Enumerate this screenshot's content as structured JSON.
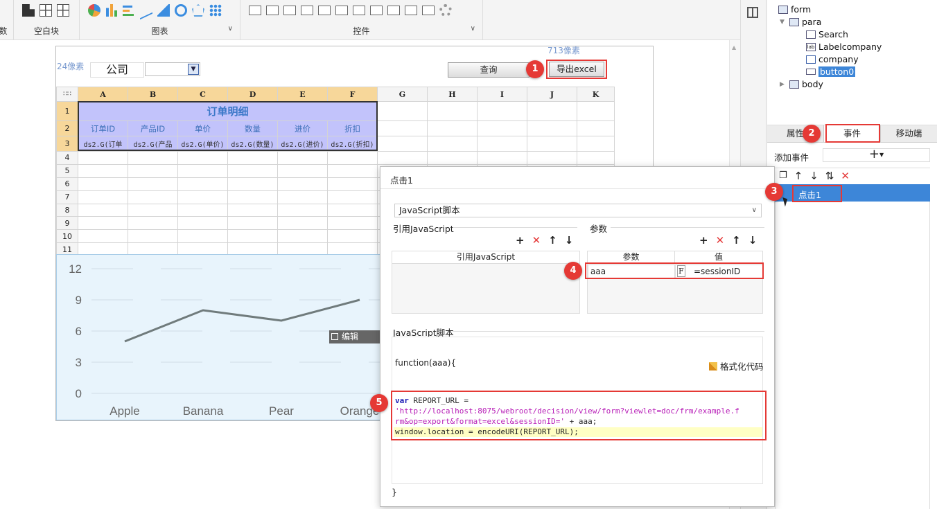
{
  "toolbar": {
    "groups": [
      {
        "label": "数"
      },
      {
        "label": "空白块"
      },
      {
        "label": "图表"
      },
      {
        "label": "控件"
      }
    ]
  },
  "report": {
    "px_left": "24像素",
    "px_top": "713像素",
    "company_label": "公司",
    "query_button": "查询",
    "export_button": "导出excel",
    "columns": [
      "A",
      "B",
      "C",
      "D",
      "E",
      "F",
      "G",
      "H",
      "I",
      "J",
      "K"
    ],
    "rows": [
      "1",
      "2",
      "3",
      "4",
      "5",
      "6",
      "7",
      "8",
      "9",
      "10",
      "11"
    ],
    "title": "订单明细",
    "headers": [
      "订单ID",
      "产品ID",
      "单价",
      "数量",
      "进价",
      "折扣"
    ],
    "formulas": [
      "ds2.G(订单",
      "ds2.G(产品",
      "ds2.G(单价)",
      "ds2.G(数量)",
      "ds2.G(进价)",
      "ds2.G(折扣)"
    ]
  },
  "chart_data": {
    "type": "line",
    "categories": [
      "Apple",
      "Banana",
      "Pear",
      "Orange"
    ],
    "series": [
      {
        "values": [
          5,
          8,
          7,
          9
        ]
      }
    ],
    "ylim": [
      0,
      12
    ],
    "yticks": [
      "0",
      "3",
      "6",
      "9",
      "12"
    ],
    "grid": true,
    "line_color": "#707b7c",
    "bg_color": "#e8f4fc"
  },
  "chart_edit_label": "编辑",
  "dialog": {
    "title": "点击1",
    "script_type": "JavaScript脚本",
    "ref_js_section": "引用JavaScript",
    "params_section": "参数",
    "ref_js_col": "引用JavaScript",
    "param_col": "参数",
    "value_col": "值",
    "param_name": "aaa",
    "param_value": "=sessionID",
    "script_section": "JavaScript脚本",
    "func_open": "function(aaa){",
    "code_kw": "var",
    "code_var": " REPORT_URL =",
    "code_url1": "'http://localhost:8075/webroot/decision/view/form?viewlet=doc/frm/example.f",
    "code_url2": "rm&op=export&format=excel&sessionID='",
    "code_tail": " + aaa;",
    "code_line3": "window.location = encodeURI(REPORT_URL);",
    "func_close": "}",
    "format_code": "格式化代码"
  },
  "tree": {
    "form": "form",
    "para": "para",
    "search": "Search",
    "labelcompany": "Labelcompany",
    "company": "company",
    "button0": "button0",
    "body": "body"
  },
  "props_tabs": [
    "属性",
    "事件",
    "移动端"
  ],
  "add_event": "添加事件",
  "event_item": "点击1",
  "markers": [
    "1",
    "2",
    "3",
    "4",
    "5"
  ],
  "colors": {
    "highlight_red": "#e53935",
    "selection_blue": "#3d86d8",
    "table_purple": "#c2c3fb",
    "header_orange": "#f7d79a"
  }
}
